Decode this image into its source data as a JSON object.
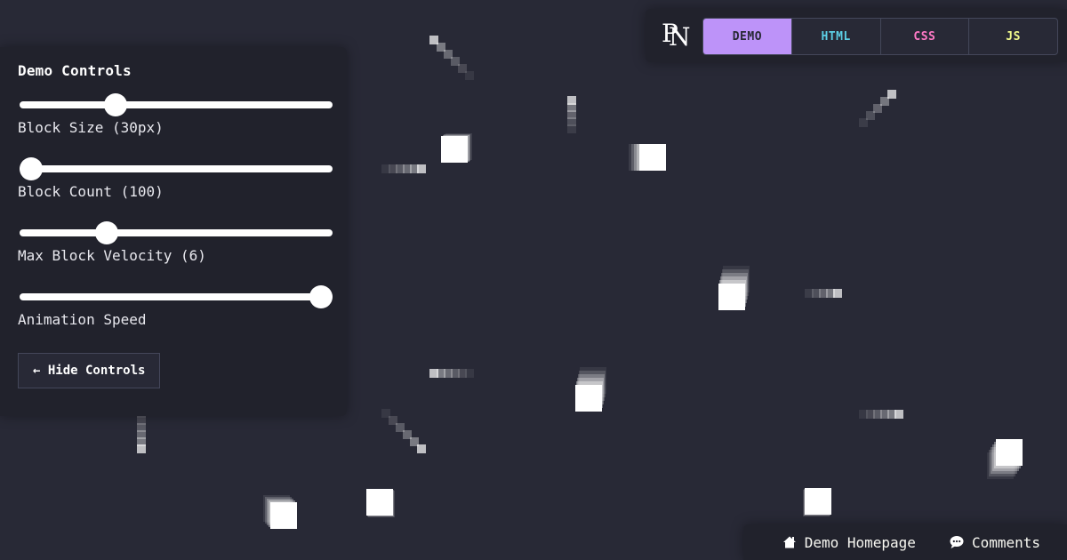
{
  "controls": {
    "title": "Demo Controls",
    "sliders": [
      {
        "label": "Block Size (30px)",
        "value_fraction": 0.29
      },
      {
        "label": "Block Count (100)",
        "value_fraction": 0.0
      },
      {
        "label": "Max Block Velocity (6)",
        "value_fraction": 0.26
      },
      {
        "label": "Animation Speed",
        "value_fraction": 1.0
      }
    ],
    "hide_button": "← Hide Controls"
  },
  "nav": {
    "logo": "PN",
    "tabs": [
      {
        "label": "DEMO",
        "active": true,
        "color": "#282936"
      },
      {
        "label": "HTML",
        "active": false,
        "color": "#5ccfe6"
      },
      {
        "label": "CSS",
        "active": false,
        "color": "#ff79c6"
      },
      {
        "label": "JS",
        "active": false,
        "color": "#f1fa8c"
      }
    ],
    "active_color": "#bd93f9"
  },
  "footer": {
    "links": [
      {
        "label": "Demo Homepage",
        "icon": "home-icon"
      },
      {
        "label": "Comments",
        "icon": "comment-icon"
      }
    ]
  },
  "colors": {
    "background": "#282936",
    "panel": "#21222c",
    "block": "#ffffff"
  }
}
